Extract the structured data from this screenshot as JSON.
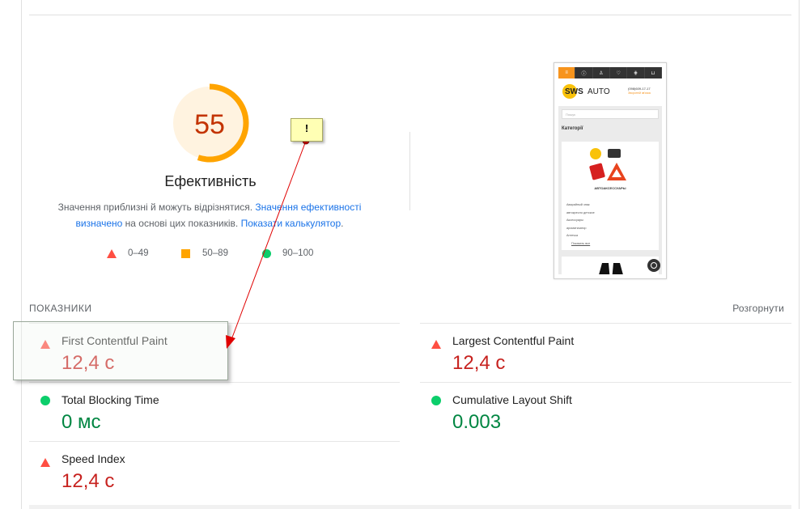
{
  "performance": {
    "score": "55",
    "score_fraction": 0.55,
    "title": "Ефективність",
    "desc_part1": "Значення приблизні й можуть відрізнятися. ",
    "desc_link1": "Значення ефективності визначено",
    "desc_part2": " на основі цих показників. ",
    "desc_link2": "Показати калькулятор",
    "desc_part3": "."
  },
  "legend": [
    {
      "range": "0–49",
      "shape": "triangle",
      "color": "#ff4e42"
    },
    {
      "range": "50–89",
      "shape": "square",
      "color": "#ffa400"
    },
    {
      "range": "90–100",
      "shape": "circle",
      "color": "#0cce6b"
    }
  ],
  "screenshot": {
    "nav_icons": [
      "menu-icon",
      "info-icon",
      "user-icon",
      "heart-icon",
      "filter-icon",
      "cart-icon"
    ],
    "logo_sws": "SWS",
    "logo_auto": "AUTO",
    "phone": "(098)609-17-17",
    "callback": "Зворотній зв'язок",
    "search_placeholder": "Пошук",
    "category_title": "Категорії",
    "card_title": "АВТОАКСЕССУАРЫ",
    "card_items": [
      "Аварийный знак",
      "автокресло детское",
      "Аксессуары",
      "ароматизатор",
      "Аптечка",
      "Показать все"
    ]
  },
  "metrics_section": {
    "label": "ПОКАЗНИКИ",
    "expand": "Розгорнути"
  },
  "metrics": [
    {
      "name": "First Contentful Paint",
      "value": "12,4 с",
      "status": "fail"
    },
    {
      "name": "Largest Contentful Paint",
      "value": "12,4 с",
      "status": "fail"
    },
    {
      "name": "Total Blocking Time",
      "value": "0 мс",
      "status": "pass"
    },
    {
      "name": "Cumulative Layout Shift",
      "value": "0.003",
      "status": "pass"
    },
    {
      "name": "Speed Index",
      "value": "12,4 с",
      "status": "fail"
    }
  ],
  "annotation": {
    "note_text": "!"
  },
  "colors": {
    "fail": "#ff4e42",
    "average": "#ffa400",
    "pass": "#0cce6b",
    "link": "#1a73e8"
  }
}
